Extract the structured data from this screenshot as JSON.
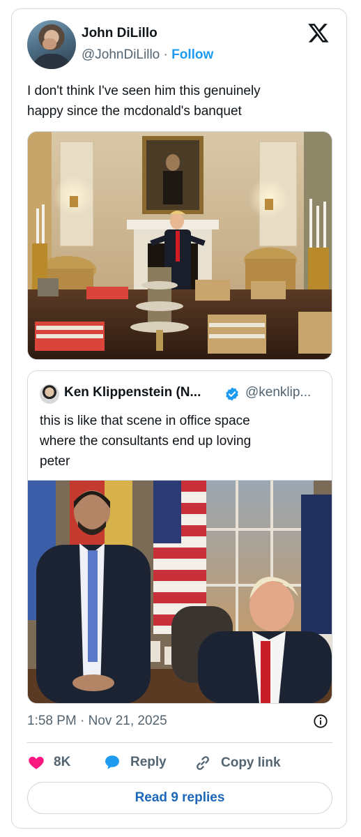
{
  "author": {
    "name": "John DiLillo",
    "handle": "@JohnDiLillo",
    "separator": "·",
    "follow_label": "Follow"
  },
  "tweet": {
    "text": "I don't think I've seen him this genuinely\nhappy since the mcdonald's banquet"
  },
  "quote": {
    "name": "Ken Klippenstein (N...",
    "handle": "@kenklip...",
    "text": "this is like that scene in office space\nwhere the consultants end up loving\npeter"
  },
  "meta": {
    "timestamp": "1:58 PM · Nov 21, 2025"
  },
  "actions": {
    "like_count": "8K",
    "reply_label": "Reply",
    "copy_label": "Copy link",
    "read_replies_label": "Read 9 replies"
  },
  "colors": {
    "accent": "#1d9bf0",
    "like": "#f91880",
    "border": "#cfd9de",
    "secondary_text": "#536471"
  },
  "icons": [
    "x-logo-icon",
    "verified-badge-icon",
    "info-icon",
    "heart-icon",
    "reply-bubble-icon",
    "link-icon"
  ]
}
